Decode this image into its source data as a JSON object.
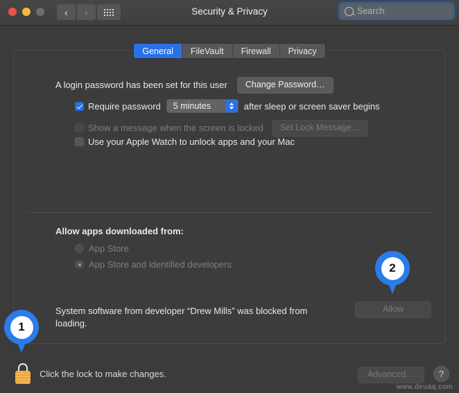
{
  "window": {
    "title": "Security & Privacy",
    "traffic_lights": [
      "close",
      "minimize",
      "zoom"
    ],
    "nav_back": "‹",
    "nav_forward": "›",
    "grid_button": "show-all"
  },
  "search": {
    "placeholder": "Search",
    "value": ""
  },
  "tabs": [
    {
      "label": "General",
      "active": true
    },
    {
      "label": "FileVault",
      "active": false
    },
    {
      "label": "Firewall",
      "active": false
    },
    {
      "label": "Privacy",
      "active": false
    }
  ],
  "general": {
    "login_password_text": "A login password has been set for this user",
    "change_password_button": "Change Password…",
    "require_password_label": "Require password",
    "require_password_value": "5 minutes",
    "require_password_suffix": "after sleep or screen saver begins",
    "show_message_label": "Show a message when the screen is locked",
    "set_lock_message_button": "Set Lock Message…",
    "apple_watch_label": "Use your Apple Watch to unlock apps and your Mac",
    "allow_apps_heading": "Allow apps downloaded from:",
    "radio_app_store": "App Store",
    "radio_app_store_identified": "App Store and identified developers",
    "blocked_message": "System software from developer “Drew Mills” was blocked from loading.",
    "allow_button": "Allow"
  },
  "bottom": {
    "lock_text": "Click the lock to make changes.",
    "advanced_button": "Advanced…",
    "help_button": "?"
  },
  "callouts": [
    {
      "number": "1"
    },
    {
      "number": "2"
    }
  ],
  "watermark": "www.deuaq.com",
  "colors": {
    "accent": "#2a71e8",
    "lock": "#efa83c",
    "pin": "#2a7ceb"
  }
}
